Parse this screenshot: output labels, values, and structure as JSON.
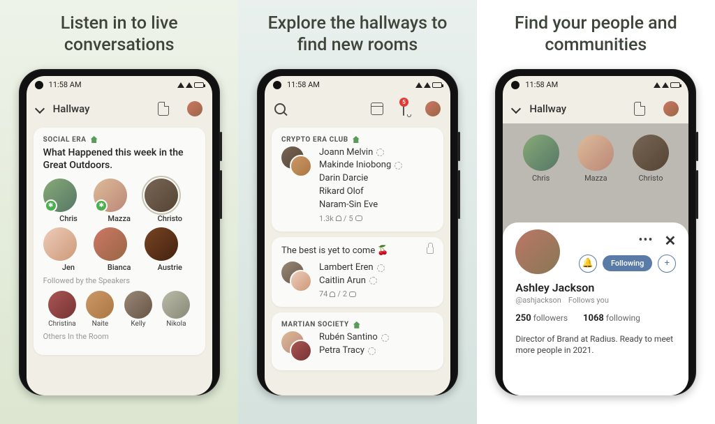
{
  "headlines": [
    "Listen in to live conversations",
    "Explore the hallways to find new rooms",
    "Find your people and communities"
  ],
  "statusbar": {
    "time": "11:58 AM"
  },
  "panel1": {
    "appbar_title": "Hallway",
    "club": "SOCIAL ERA",
    "room_title": "What Happened this week in the Great Outdoors.",
    "speakers": [
      "Chris",
      "Mazza",
      "Christo",
      "Jen",
      "Bianca",
      "Austrie"
    ],
    "section_followed": "Followed by the Speakers",
    "followed": [
      "Christina",
      "Naite",
      "Kelly",
      "Nikola"
    ],
    "section_others": "Others In the Room"
  },
  "panel2": {
    "notif_count": "5",
    "room1": {
      "club": "CRYPTO ERA CLUB",
      "speakers": [
        "Joann Melvin",
        "Makinde Iniobong",
        "Darin Darcie",
        "Rikard Olof",
        "Naram-Sin Eve"
      ],
      "listeners": "1.3k",
      "chatters": "5"
    },
    "room2": {
      "title": "The best is yet to come 🍒",
      "speakers": [
        "Lambert Eren",
        "Caitlin Arun"
      ],
      "listeners": "74",
      "chatters": "2"
    },
    "room3": {
      "club": "MARTIAN SOCIETY",
      "speakers": [
        "Rubén Santino",
        "Petra Tracy"
      ]
    }
  },
  "panel3": {
    "appbar_title": "Hallway",
    "ghost_speakers": [
      "Chris",
      "Mazza",
      "Christo"
    ],
    "following_label": "Following",
    "name": "Ashley Jackson",
    "handle": "@ashjackson",
    "follows_you": "Follows you",
    "followers_n": "250",
    "followers_l": "followers",
    "following_n": "1068",
    "following_l": "following",
    "bio": "Director of Brand at Radius. Ready to meet more people in 2021."
  }
}
